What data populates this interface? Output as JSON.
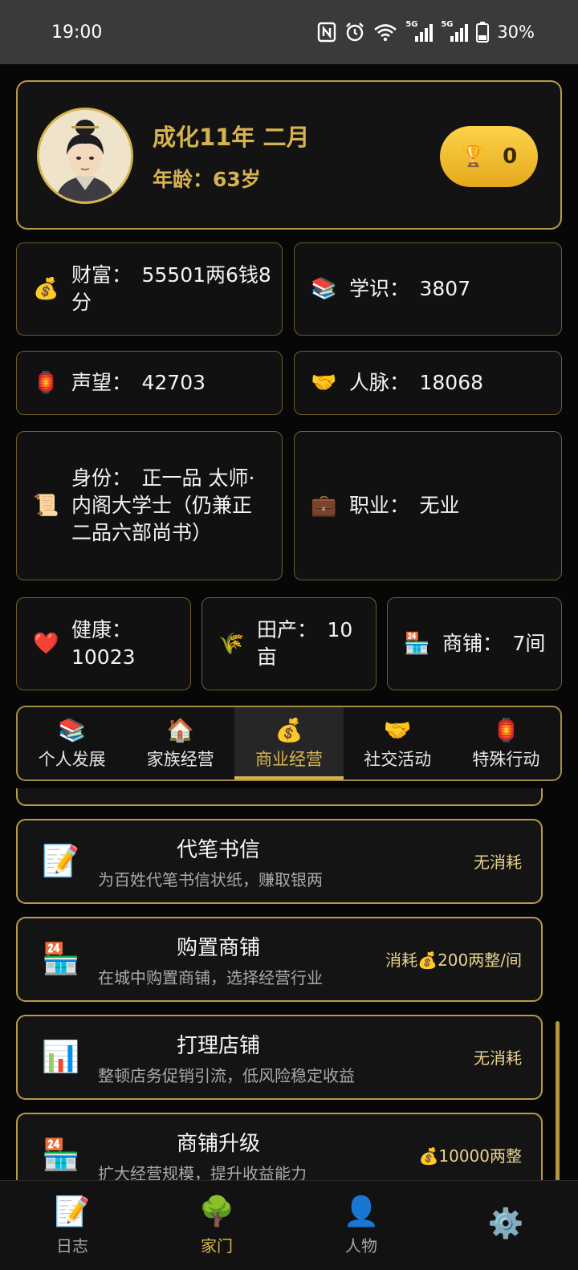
{
  "status_bar": {
    "time": "19:00",
    "battery": "30%",
    "net1": "5G",
    "net2": "5G"
  },
  "profile": {
    "date": "成化11年 二月",
    "age": "年龄：63岁",
    "trophy_count": "0"
  },
  "stats": {
    "wealth": {
      "icon": "money-bag",
      "text": "财富：　55501两6钱8分"
    },
    "knowledge": {
      "icon": "books",
      "text": "学识：　3807"
    },
    "prestige": {
      "icon": "lantern",
      "text": "声望：　42703"
    },
    "connections": {
      "icon": "handshake",
      "text": "人脉：　18068"
    },
    "identity": {
      "icon": "scroll",
      "text": "身份：　正一品 太师·内阁大学士（仍兼正二品六部尚书）"
    },
    "occupation": {
      "icon": "briefcase",
      "text": "职业：　无业"
    },
    "health": {
      "icon": "heart",
      "text": "健康：　10023"
    },
    "farmland": {
      "icon": "rice",
      "text": "田产：　10亩"
    },
    "shops": {
      "icon": "store",
      "text": "商铺：　7间"
    }
  },
  "tabs": [
    {
      "icon": "📚",
      "label": "个人发展"
    },
    {
      "icon": "🏠",
      "label": "家族经营"
    },
    {
      "icon": "💰",
      "label": "商业经营"
    },
    {
      "icon": "🤝",
      "label": "社交活动"
    },
    {
      "icon": "🏮",
      "label": "特殊行动"
    }
  ],
  "actions": [
    {
      "icon": "📝",
      "title": "代笔书信",
      "desc": "为百姓代笔书信状纸，赚取银两",
      "cost": "无消耗"
    },
    {
      "icon": "🏪",
      "title": "购置商铺",
      "desc": "在城中购置商铺，选择经营行业",
      "cost": "消耗💰200两整/间"
    },
    {
      "icon": "📊",
      "title": "打理店铺",
      "desc": "整顿店务促销引流，低风险稳定收益",
      "cost": "无消耗"
    },
    {
      "icon": "🏪",
      "title": "商铺升级",
      "desc": "扩大经营规模，提升收益能力",
      "cost": "💰10000两整"
    }
  ],
  "nav": [
    {
      "icon": "📝",
      "label": "日志"
    },
    {
      "icon": "🌳",
      "label": "家门"
    },
    {
      "icon": "👤",
      "label": "人物"
    },
    {
      "icon": "⚙️",
      "label": ""
    }
  ]
}
